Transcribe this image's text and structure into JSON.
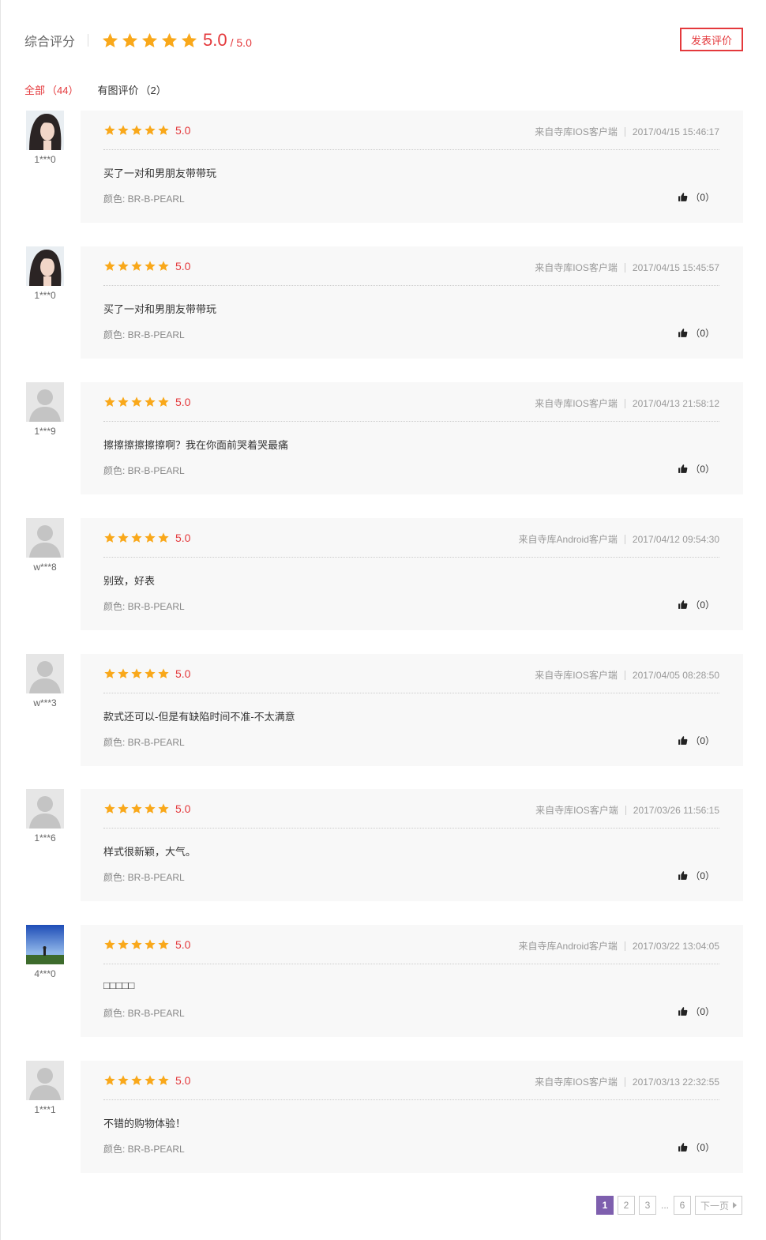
{
  "summary": {
    "label": "综合评分",
    "score": "5.0",
    "max": "/ 5.0",
    "stars": 5,
    "write_button": "发表评价"
  },
  "tabs": [
    {
      "label": "全部",
      "count": "（44）",
      "active": true
    },
    {
      "label": "有图评价",
      "count": "（2）",
      "active": false
    }
  ],
  "colors": {
    "accent_red": "#e4393c",
    "star": "#f9a81a",
    "page_current": "#7e5fae"
  },
  "reviews": [
    {
      "user": "1***0",
      "avatar": "photo-woman",
      "score": "5.0",
      "source": "来自寺库IOS客户端",
      "time": "2017/04/15 15:46:17",
      "content": "买了一对和男朋友带带玩",
      "attr": "颜色: BR-B-PEARL",
      "likes": "（0）"
    },
    {
      "user": "1***0",
      "avatar": "photo-woman",
      "score": "5.0",
      "source": "来自寺库IOS客户端",
      "time": "2017/04/15 15:45:57",
      "content": "买了一对和男朋友带带玩",
      "attr": "颜色: BR-B-PEARL",
      "likes": "（0）"
    },
    {
      "user": "1***9",
      "avatar": "default",
      "score": "5.0",
      "source": "来自寺库IOS客户端",
      "time": "2017/04/13 21:58:12",
      "content": "擦擦擦擦擦擦啊？我在你面前哭着哭最痛",
      "attr": "颜色: BR-B-PEARL",
      "likes": "（0）"
    },
    {
      "user": "w***8",
      "avatar": "default",
      "score": "5.0",
      "source": "来自寺库Android客户端",
      "time": "2017/04/12 09:54:30",
      "content": "别致，好表",
      "attr": "颜色: BR-B-PEARL",
      "likes": "（0）"
    },
    {
      "user": "w***3",
      "avatar": "default",
      "score": "5.0",
      "source": "来自寺库IOS客户端",
      "time": "2017/04/05 08:28:50",
      "content": "款式还可以-但是有缺陷时间不准-不太满意",
      "attr": "颜色: BR-B-PEARL",
      "likes": "（0）"
    },
    {
      "user": "1***6",
      "avatar": "default",
      "score": "5.0",
      "source": "来自寺库IOS客户端",
      "time": "2017/03/26 11:56:15",
      "content": "样式很新颖，大气。",
      "attr": "颜色: BR-B-PEARL",
      "likes": "（0）"
    },
    {
      "user": "4***0",
      "avatar": "photo-sky",
      "score": "5.0",
      "source": "来自寺库Android客户端",
      "time": "2017/03/22 13:04:05",
      "content": "□□□□□",
      "attr": "颜色: BR-B-PEARL",
      "likes": "（0）"
    },
    {
      "user": "1***1",
      "avatar": "default",
      "score": "5.0",
      "source": "来自寺库IOS客户端",
      "time": "2017/03/13 22:32:55",
      "content": "不错的购物体验！",
      "attr": "颜色: BR-B-PEARL",
      "likes": "（0）"
    }
  ],
  "pagination": {
    "pages": [
      "1",
      "2",
      "3"
    ],
    "current": "1",
    "ellipsis": "...",
    "last": "6",
    "next_label": "下一页"
  }
}
